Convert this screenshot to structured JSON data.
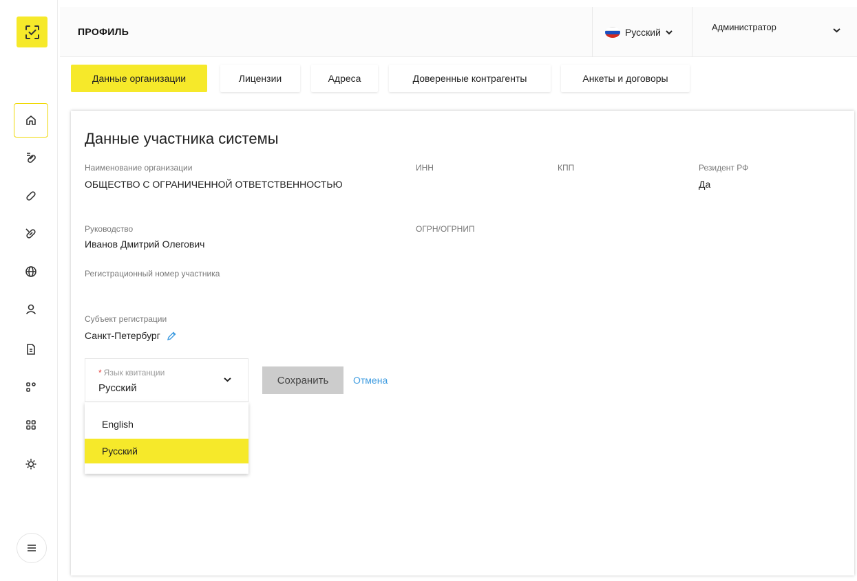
{
  "header": {
    "title": "ПРОФИЛЬ",
    "language": "Русский",
    "user": "Администратор"
  },
  "tabs": [
    {
      "label": "Данные организации",
      "active": true
    },
    {
      "label": "Лицензии",
      "active": false
    },
    {
      "label": "Адреса",
      "active": false
    },
    {
      "label": "Доверенные контрагенты",
      "active": false
    },
    {
      "label": "Анкеты и договоры",
      "active": false
    }
  ],
  "sidebar": {
    "icons": [
      "home-icon",
      "pill-list-icon",
      "pill-icon",
      "pill-slash-icon",
      "globe-icon",
      "user-icon",
      "document-icon",
      "blocks-icon",
      "grid-icon",
      "settings-icon"
    ],
    "menu_icon": "menu-icon"
  },
  "card": {
    "title": "Данные участника системы",
    "org_name_label": "Наименование организации",
    "org_name_value": "ОБЩЕСТВО С ОГРАНИЧЕННОЙ ОТВЕТСТВЕННОСТЬЮ",
    "inn_label": "ИНН",
    "kpp_label": "КПП",
    "resident_label": "Резидент РФ",
    "resident_value": "Да",
    "management_label": "Руководство",
    "management_value": "Иванов Дмитрий Олегович",
    "ogrn_label": "ОГРН/ОГРНИП",
    "reg_number_label": "Регистрационный номер участника",
    "subject_label": "Субъект регистрации",
    "subject_value": "Санкт-Петербург"
  },
  "receipt_language": {
    "required_mark": "*",
    "label": "Язык квитанции",
    "value": "Русский",
    "options": [
      "English",
      "Русский"
    ],
    "selected": "Русский"
  },
  "actions": {
    "save_label": "Сохранить",
    "cancel_label": "Отмена"
  },
  "colors": {
    "accent": "#f6e92a",
    "link": "#3d9be0",
    "disabled_button": "#cccccc",
    "required": "#e53935"
  }
}
